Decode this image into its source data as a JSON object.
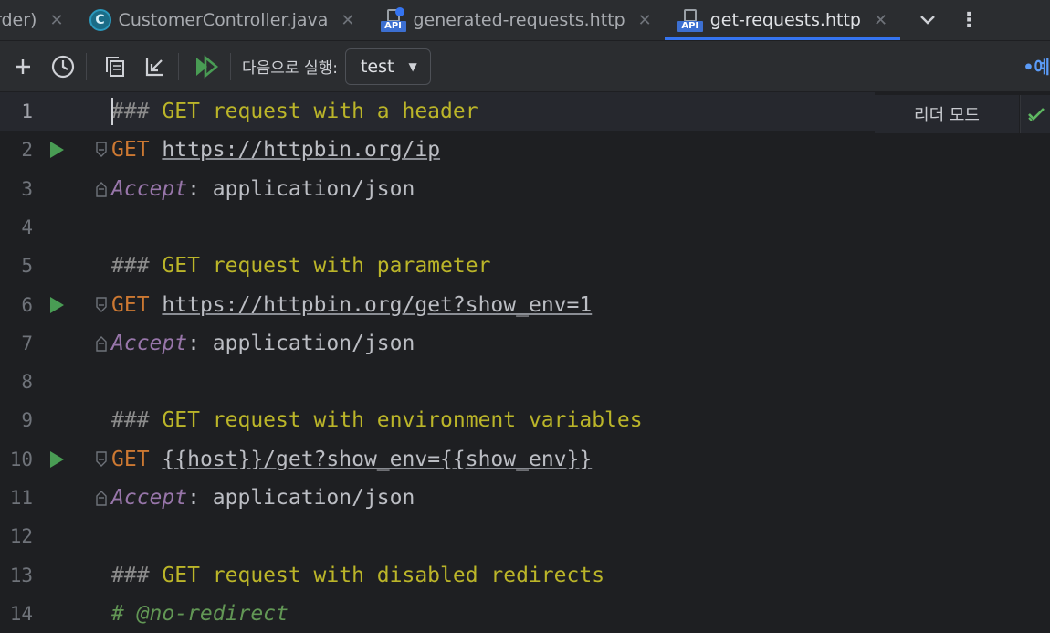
{
  "tabs": [
    {
      "label": "rder)",
      "icon": "none",
      "active": false
    },
    {
      "label": "CustomerController.java",
      "icon": "java-class-icon",
      "active": false
    },
    {
      "label": "generated-requests.http",
      "icon": "http-api-file-icon",
      "active": false
    },
    {
      "label": "get-requests.http",
      "icon": "http-api-file-icon",
      "active": true
    }
  ],
  "java_icon_letter": "C",
  "api_badge": "API",
  "toolbar": {
    "run_with_label": "다음으로 실행:",
    "environment_value": "test",
    "right_cutoff_text": "•예"
  },
  "reader_mode": "리더 모드",
  "accent_color": "#3574f0",
  "run_color": "#499c54",
  "lines": [
    {
      "n": "1",
      "parts": [
        {
          "t": "###",
          "c": "c-comment-hash"
        },
        {
          "t": " GET request with a header",
          "c": "c-comment"
        }
      ]
    },
    {
      "n": "2",
      "parts": [
        {
          "t": "GET",
          "c": "c-method"
        },
        {
          "t": " ",
          "c": "c-plain"
        },
        {
          "t": "https://httpbin.org/ip",
          "c": "c-url"
        }
      ]
    },
    {
      "n": "3",
      "parts": [
        {
          "t": "Accept",
          "c": "c-header"
        },
        {
          "t": ": application/json",
          "c": "c-plain"
        }
      ]
    },
    {
      "n": "4",
      "parts": []
    },
    {
      "n": "5",
      "parts": [
        {
          "t": "###",
          "c": "c-comment-hash"
        },
        {
          "t": " GET request with parameter",
          "c": "c-comment"
        }
      ]
    },
    {
      "n": "6",
      "parts": [
        {
          "t": "GET",
          "c": "c-method"
        },
        {
          "t": " ",
          "c": "c-plain"
        },
        {
          "t": "https://httpbin.org/get?show_env=1",
          "c": "c-url"
        }
      ]
    },
    {
      "n": "7",
      "parts": [
        {
          "t": "Accept",
          "c": "c-header"
        },
        {
          "t": ": application/json",
          "c": "c-plain"
        }
      ]
    },
    {
      "n": "8",
      "parts": []
    },
    {
      "n": "9",
      "parts": [
        {
          "t": "###",
          "c": "c-comment-hash"
        },
        {
          "t": " GET request with environment variables",
          "c": "c-comment"
        }
      ]
    },
    {
      "n": "10",
      "parts": [
        {
          "t": "GET",
          "c": "c-method"
        },
        {
          "t": " ",
          "c": "c-plain"
        },
        {
          "t": "{{host}}/get?show_env={{show_env}}",
          "c": "c-url"
        }
      ]
    },
    {
      "n": "11",
      "parts": [
        {
          "t": "Accept",
          "c": "c-header"
        },
        {
          "t": ": application/json",
          "c": "c-plain"
        }
      ]
    },
    {
      "n": "12",
      "parts": []
    },
    {
      "n": "13",
      "parts": [
        {
          "t": "###",
          "c": "c-comment-hash"
        },
        {
          "t": " GET request with disabled redirects",
          "c": "c-comment"
        }
      ]
    },
    {
      "n": "14",
      "parts": [
        {
          "t": "# @no-redirect",
          "c": "c-dircomment"
        }
      ]
    }
  ]
}
